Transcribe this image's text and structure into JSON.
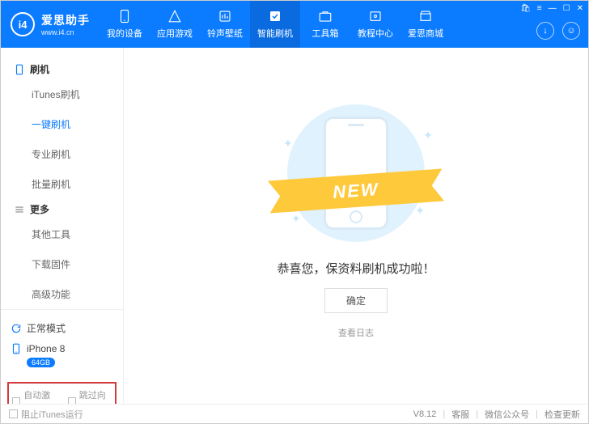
{
  "header": {
    "app_name": "爱思助手",
    "url": "www.i4.cn",
    "logo_initials": "i4",
    "nav": [
      {
        "label": "我的设备"
      },
      {
        "label": "应用游戏"
      },
      {
        "label": "铃声壁纸"
      },
      {
        "label": "智能刷机"
      },
      {
        "label": "工具箱"
      },
      {
        "label": "教程中心"
      },
      {
        "label": "爱思商城"
      }
    ],
    "active_nav_index": 3
  },
  "sidebar": {
    "groups": [
      {
        "title": "刷机",
        "icon": "phone-outline",
        "items": [
          "iTunes刷机",
          "一键刷机",
          "专业刷机",
          "批量刷机"
        ],
        "active_index": 1
      },
      {
        "title": "更多",
        "icon": "menu-icon",
        "items": [
          "其他工具",
          "下载固件",
          "高级功能"
        ],
        "active_index": -1
      }
    ],
    "mode_label": "正常模式",
    "device": {
      "name": "iPhone 8",
      "storage": "64GB"
    },
    "checkboxes": [
      {
        "label": "自动激活"
      },
      {
        "label": "跳过向导"
      }
    ]
  },
  "main": {
    "banner_text": "NEW",
    "success_text": "恭喜您，保资料刷机成功啦！",
    "confirm_label": "确定",
    "log_label": "查看日志"
  },
  "footer": {
    "stop_itunes_label": "阻止iTunes运行",
    "version": "V8.12",
    "links": [
      "客服",
      "微信公众号",
      "检查更新"
    ]
  }
}
